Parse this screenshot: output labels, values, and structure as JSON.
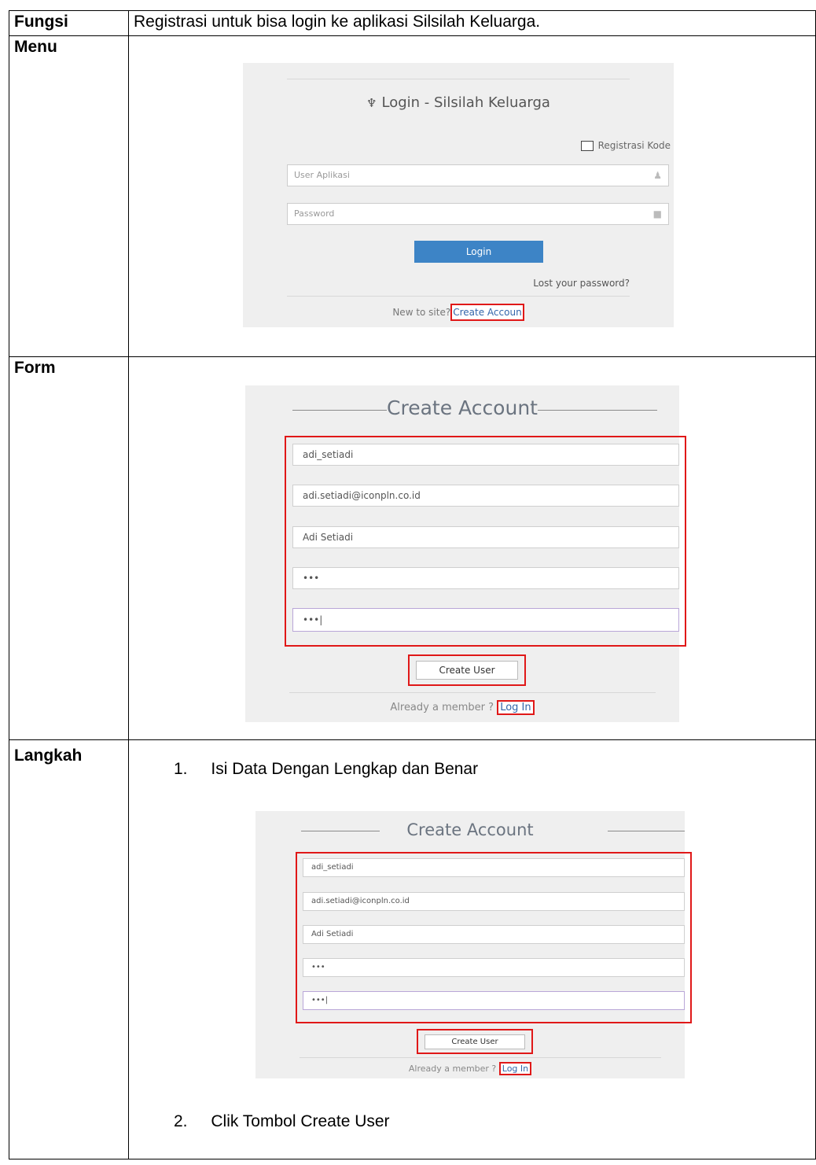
{
  "rows": {
    "fungsi": {
      "label": "Fungsi",
      "text": "Registrasi untuk bisa login ke aplikasi Silsilah Keluarga."
    },
    "menu": {
      "label": "Menu"
    },
    "form": {
      "label": "Form"
    },
    "langkah": {
      "label": "Langkah"
    }
  },
  "login_screen": {
    "title": "Login - Silsilah Keluarga",
    "title_icon": "tree-icon",
    "registrasi_kode": "Registrasi Kode",
    "user_placeholder": "User Aplikasi",
    "password_placeholder": "Password",
    "login_button": "Login",
    "lost_password": "Lost your password?",
    "new_to_site": "New to site?",
    "create_account_link": "Create Accoun"
  },
  "create_account": {
    "title": "Create Account",
    "username": "adi_setiadi",
    "email": "adi.setiadi@iconpln.co.id",
    "full_name": "Adi Setiadi",
    "password": "•••",
    "confirm_password": "•••|",
    "create_button": "Create User",
    "already_member": "Already a member ?",
    "login_link": "Log In"
  },
  "steps": [
    {
      "number": "1.",
      "text": "Isi Data Dengan Lengkap dan Benar"
    },
    {
      "number": "2.",
      "text": "Clik Tombol Create User"
    }
  ],
  "colors": {
    "highlight": "#e01818",
    "login_button": "#3d84c6",
    "screenshot_bg": "#efefef"
  }
}
